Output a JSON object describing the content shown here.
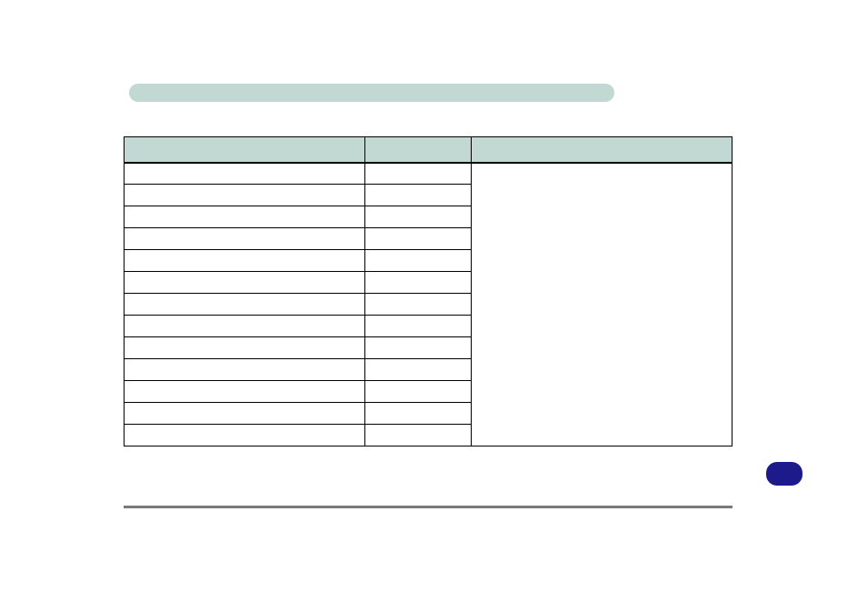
{
  "header": {
    "title": ""
  },
  "table": {
    "headers": {
      "col_a": "",
      "col_b": "",
      "col_c": ""
    },
    "rows": [
      {
        "a": "",
        "b": ""
      },
      {
        "a": "",
        "b": ""
      },
      {
        "a": "",
        "b": ""
      },
      {
        "a": "",
        "b": ""
      },
      {
        "a": "",
        "b": ""
      },
      {
        "a": "",
        "b": ""
      },
      {
        "a": "",
        "b": ""
      },
      {
        "a": "",
        "b": ""
      },
      {
        "a": "",
        "b": ""
      },
      {
        "a": "",
        "b": ""
      },
      {
        "a": "",
        "b": ""
      },
      {
        "a": "",
        "b": ""
      },
      {
        "a": "",
        "b": ""
      }
    ],
    "notes": ""
  },
  "page_number": ""
}
